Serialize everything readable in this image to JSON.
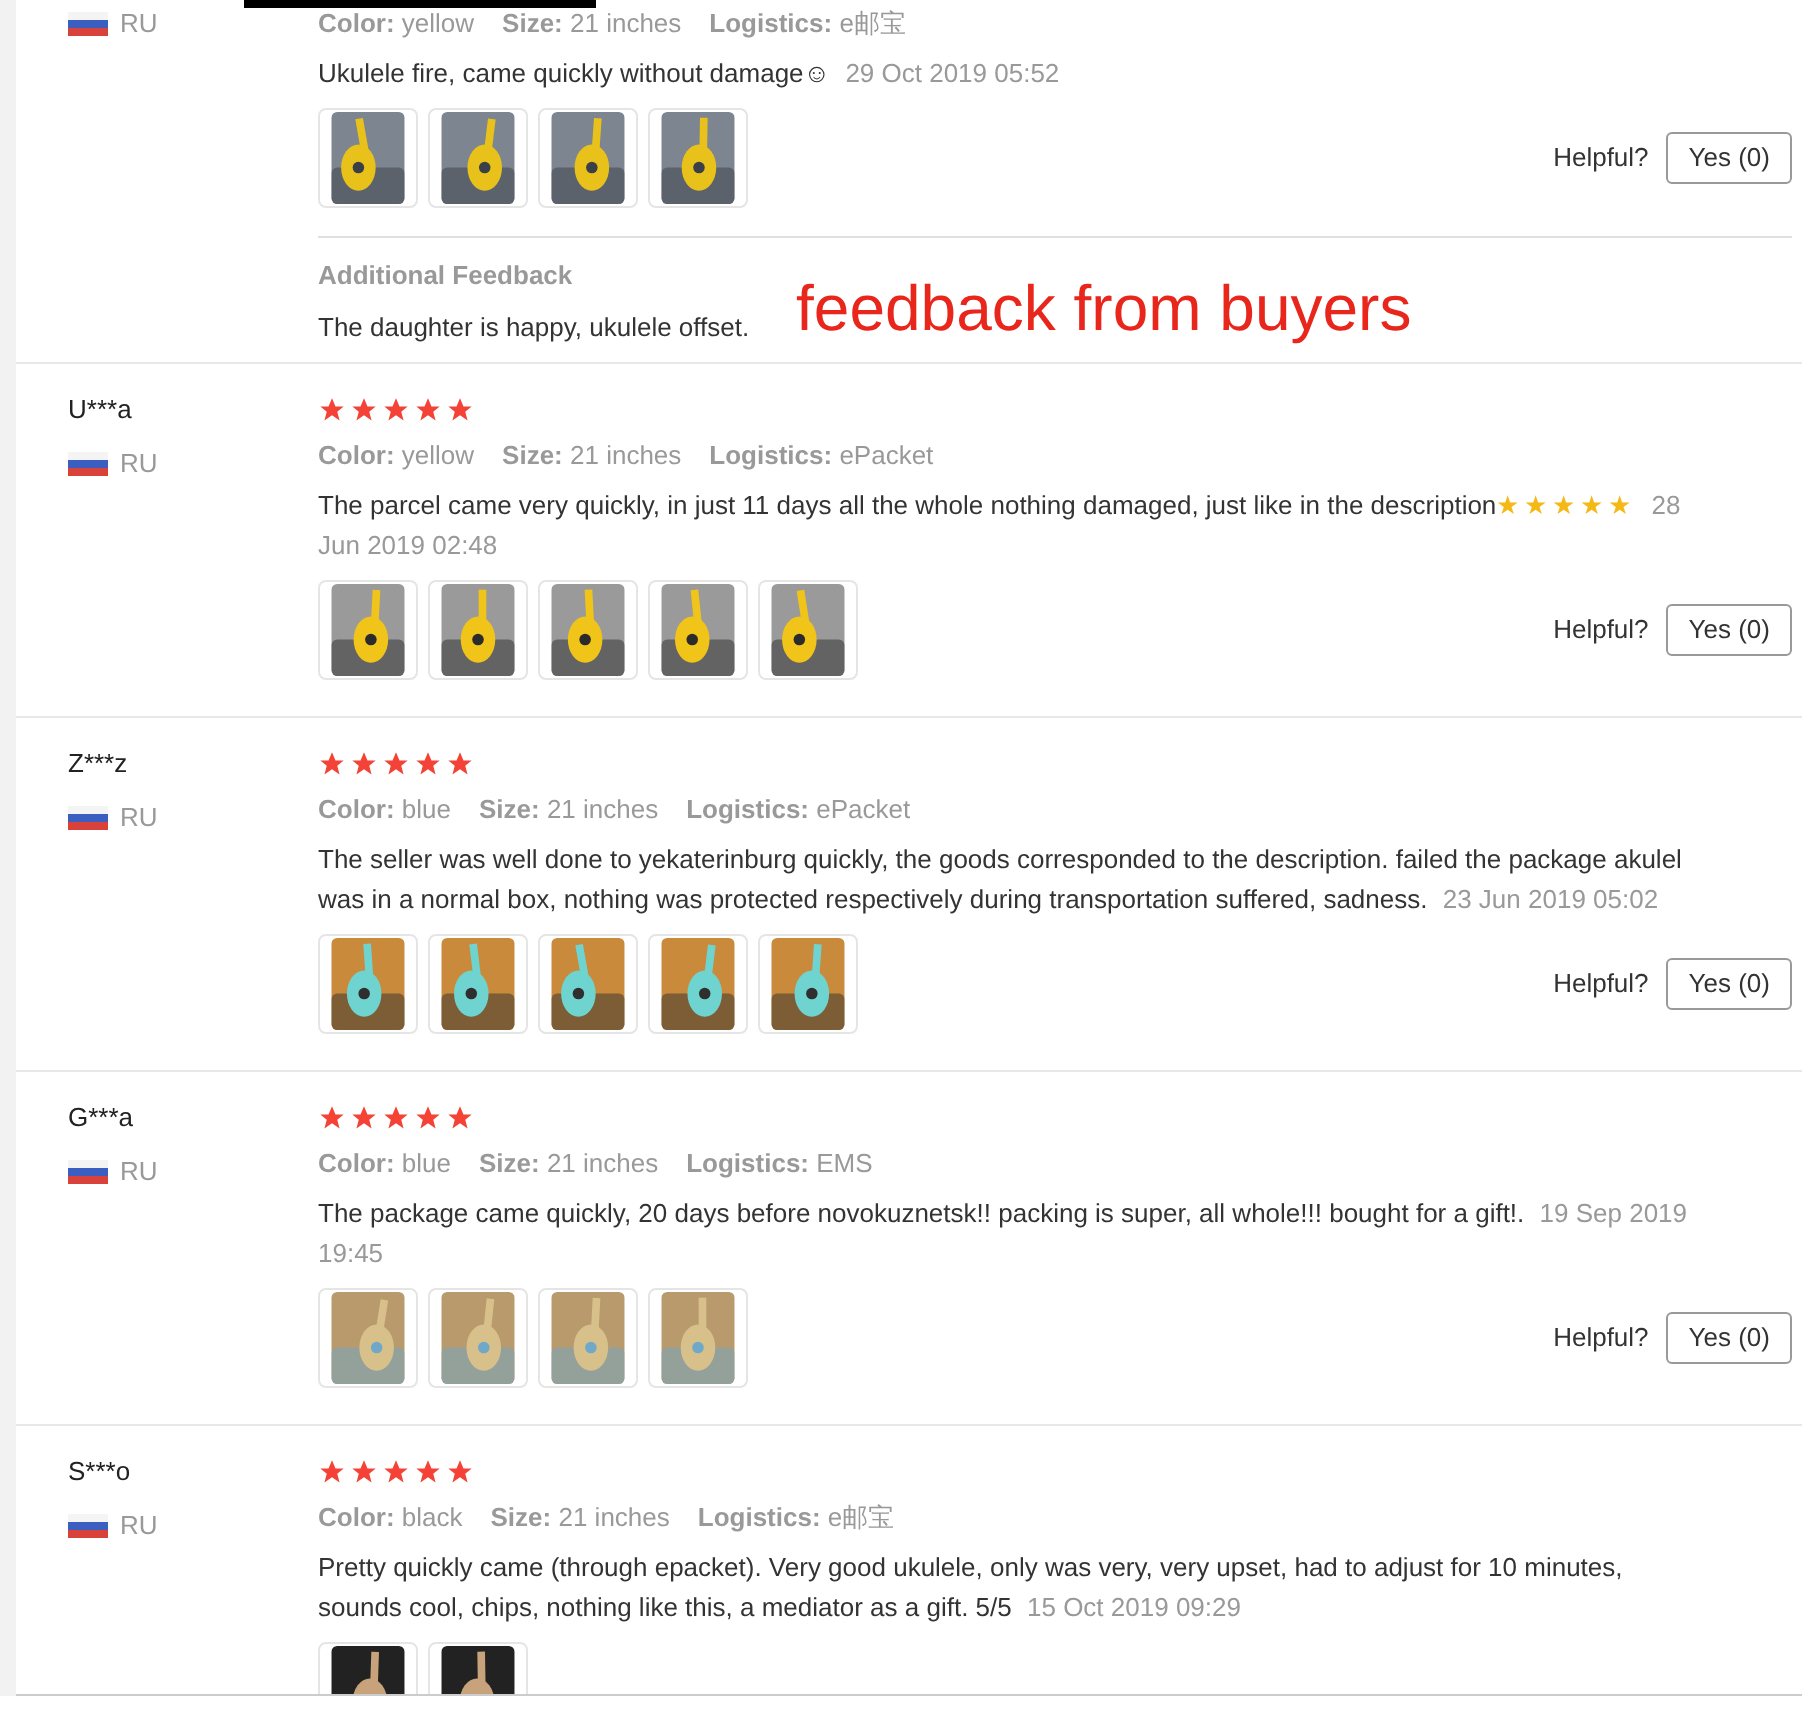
{
  "annotation": "feedback from buyers",
  "reviews": [
    {
      "country": "RU",
      "meta": [
        {
          "label": "Color:",
          "value": "yellow"
        },
        {
          "label": "Size:",
          "value": "21 inches"
        },
        {
          "label": "Logistics:",
          "value": "e邮宝"
        }
      ],
      "text": "Ukulele fire, came quickly without damage☺",
      "date": "29 Oct 2019 05:52",
      "photos": [
        {
          "kind": "picture"
        },
        {
          "kind": "picture"
        },
        {
          "kind": "picture"
        },
        {
          "kind": "picture"
        }
      ],
      "helpful": "Helpful?",
      "vote": "Yes (0)",
      "additional": {
        "title": "Additional Feedback",
        "text": "The daughter is happy, ukulele offset."
      }
    },
    {
      "name": "U***a",
      "country": "RU",
      "stars": 5,
      "meta": [
        {
          "label": "Color:",
          "value": "yellow"
        },
        {
          "label": "Size:",
          "value": "21 inches"
        },
        {
          "label": "Logistics:",
          "value": "ePacket"
        }
      ],
      "text": "The parcel came very quickly, in just 11 days all the whole nothing damaged, just like in the description",
      "text_stars": "★★★★★",
      "date": "28 Jun 2019 02:48",
      "photos": [
        {
          "kind": "picture"
        },
        {
          "kind": "picture"
        },
        {
          "kind": "picture"
        },
        {
          "kind": "picture"
        },
        {
          "kind": "picture"
        }
      ],
      "helpful": "Helpful?",
      "vote": "Yes (0)"
    },
    {
      "name": "Z***z",
      "country": "RU",
      "stars": 5,
      "meta": [
        {
          "label": "Color:",
          "value": "blue"
        },
        {
          "label": "Size:",
          "value": "21 inches"
        },
        {
          "label": "Logistics:",
          "value": "ePacket"
        }
      ],
      "text": "The seller was well done to yekaterinburg quickly, the goods corresponded to the description. failed the package akulel was in a normal box, nothing was protected respectively during transportation suffered, sadness.",
      "date": "23 Jun 2019 05:02",
      "photos": [
        {
          "kind": "picture"
        },
        {
          "kind": "picture"
        },
        {
          "kind": "picture"
        },
        {
          "kind": "picture"
        },
        {
          "kind": "picture"
        }
      ],
      "helpful": "Helpful?",
      "vote": "Yes (0)"
    },
    {
      "name": "G***a",
      "country": "RU",
      "stars": 5,
      "meta": [
        {
          "label": "Color:",
          "value": "blue"
        },
        {
          "label": "Size:",
          "value": "21 inches"
        },
        {
          "label": "Logistics:",
          "value": "EMS"
        }
      ],
      "text": "The package came quickly, 20 days before novokuznetsk!! packing is super, all whole!!! bought for a gift!.",
      "date": "19 Sep 2019 19:45",
      "photos": [
        {
          "kind": "picture"
        },
        {
          "kind": "picture"
        },
        {
          "kind": "picture"
        },
        {
          "kind": "picture"
        }
      ],
      "helpful": "Helpful?",
      "vote": "Yes (0)"
    },
    {
      "name": "S***o",
      "country": "RU",
      "stars": 5,
      "meta": [
        {
          "label": "Color:",
          "value": "black"
        },
        {
          "label": "Size:",
          "value": "21 inches"
        },
        {
          "label": "Logistics:",
          "value": "e邮宝"
        }
      ],
      "text": "Pretty quickly came (through epacket). Very good ukulele, only was very, very upset, had to adjust for 10 minutes, sounds cool, chips, nothing like this, a mediator as a gift. 5/5",
      "date": "15 Oct 2019 09:29",
      "photos": [
        {
          "kind": "picture"
        },
        {
          "kind": "picture"
        }
      ]
    }
  ]
}
